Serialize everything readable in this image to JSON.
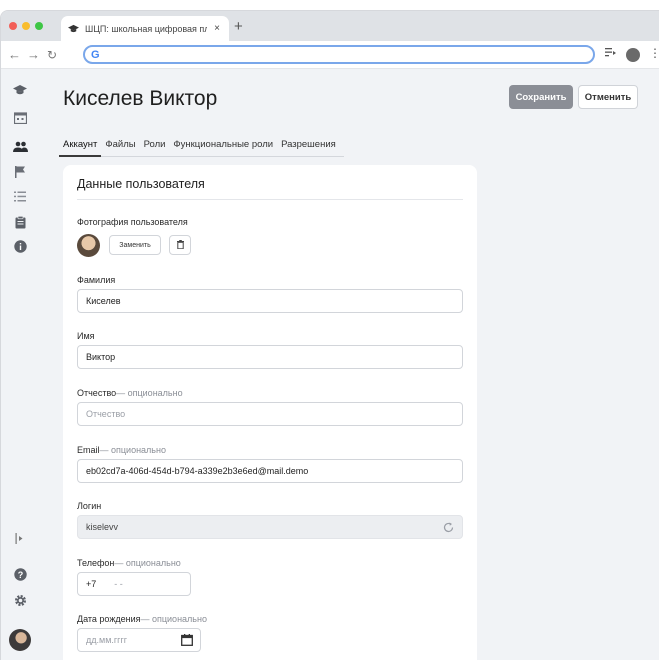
{
  "browser": {
    "tab_title": "ШЦП: школьная цифровая пл",
    "tab_close": "×",
    "new_tab": "+",
    "address_icon": "G"
  },
  "page": {
    "title": "Киселев Виктор",
    "save_label": "Сохранить",
    "cancel_label": "Отменить"
  },
  "tabs": [
    {
      "label": "Аккаунт",
      "active": true
    },
    {
      "label": "Файлы",
      "active": false
    },
    {
      "label": "Роли",
      "active": false
    },
    {
      "label": "Функциональные роли",
      "active": false
    },
    {
      "label": "Разрешения",
      "active": false
    }
  ],
  "card": {
    "title": "Данные пользователя",
    "photo_label": "Фотография пользователя",
    "replace_label": "Заменить",
    "optional_suffix": "— опционально",
    "fields": {
      "last_name": {
        "label": "Фамилия",
        "value": "Киселев"
      },
      "first_name": {
        "label": "Имя",
        "value": "Виктор"
      },
      "middle_name": {
        "label": "Отчество",
        "placeholder": "Отчество"
      },
      "email": {
        "label": "Email",
        "value": "eb02cd7a-406d-454d-b794-a339e2b3e6ed@mail.demo"
      },
      "login": {
        "label": "Логин",
        "value": "kiselevv"
      },
      "phone": {
        "label": "Телефон",
        "prefix": "+7",
        "mask": "- -"
      },
      "birthdate": {
        "label": "Дата рождения",
        "placeholder": "дд.мм.гггг"
      }
    }
  },
  "colors": {
    "save_button": "#8b8e96",
    "page_background": "#f1f3f6"
  }
}
